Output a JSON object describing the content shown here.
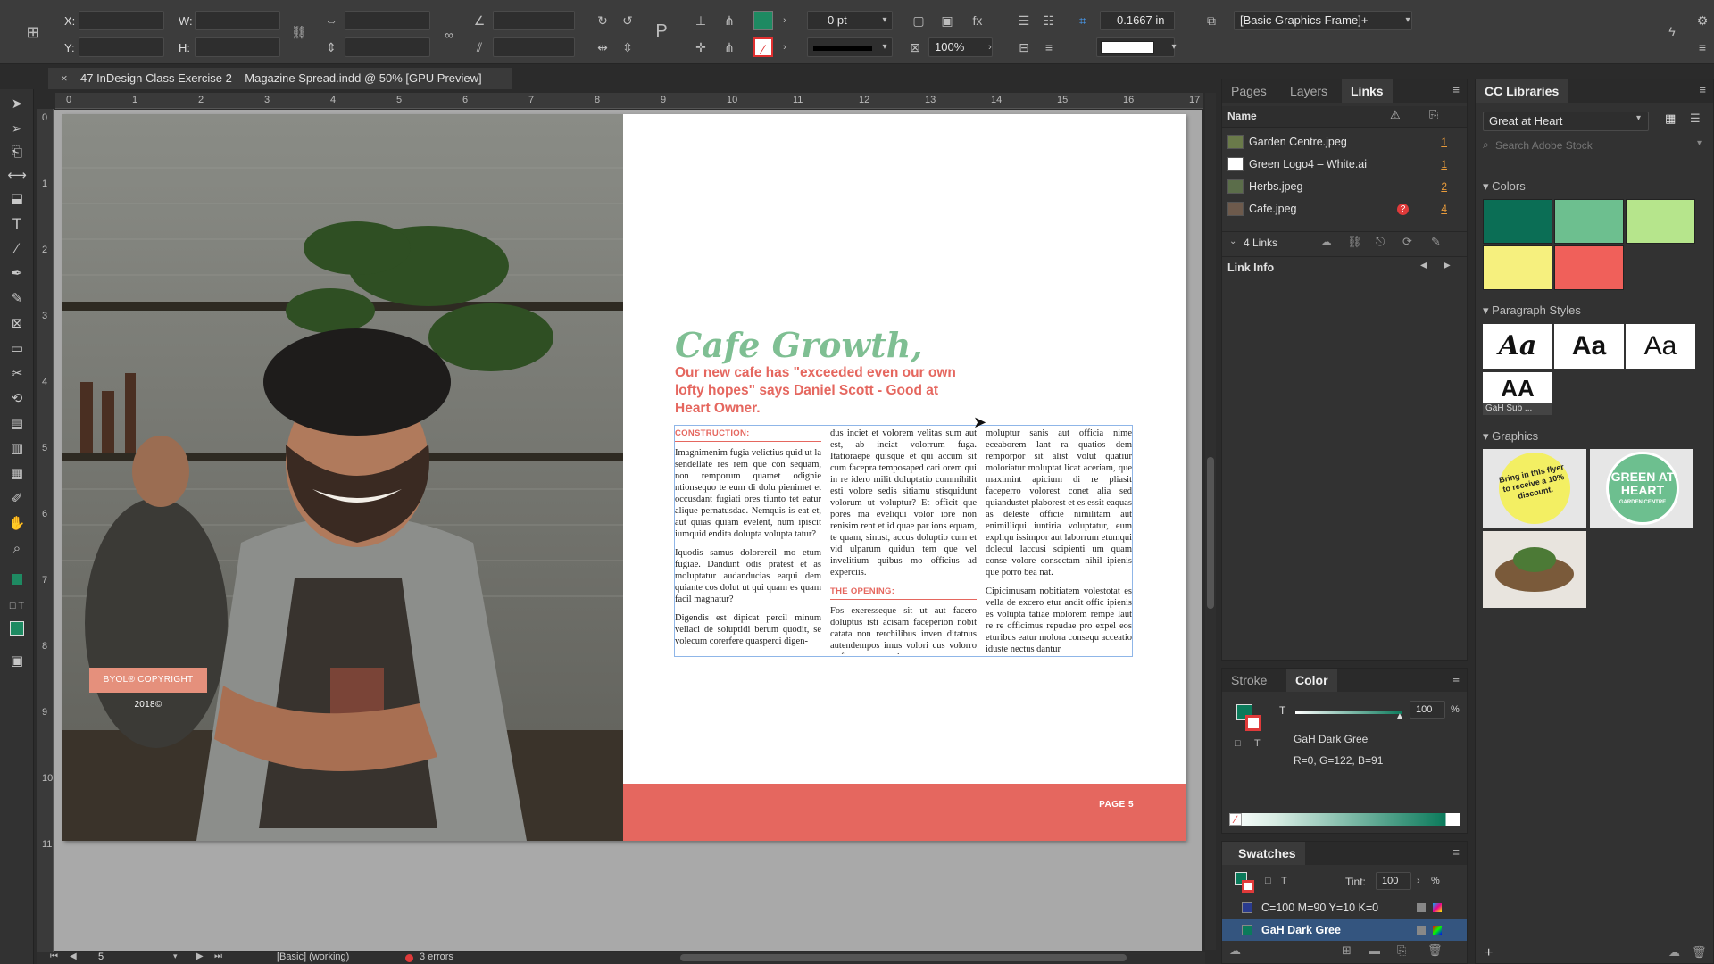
{
  "control_bar": {
    "x_label": "X:",
    "y_label": "Y:",
    "w_label": "W:",
    "h_label": "H:",
    "stroke_weight": "0 pt",
    "opacity": "100%",
    "offset": "0.1667 in",
    "object_style": "[Basic Graphics Frame]+"
  },
  "document": {
    "tab_title": "47 InDesign Class Exercise 2 – Magazine Spread.indd @ 50% [GPU Preview]",
    "close_glyph": "×"
  },
  "ruler": {
    "h_ticks": [
      "0",
      "1",
      "2",
      "3",
      "4",
      "5",
      "6",
      "7",
      "8",
      "9",
      "10",
      "11",
      "12",
      "13",
      "14",
      "15",
      "16",
      "17"
    ],
    "v_ticks": [
      "0",
      "1",
      "2",
      "3",
      "4",
      "5",
      "6",
      "7",
      "8",
      "9",
      "10",
      "11"
    ]
  },
  "spread": {
    "copyright": "BYOL® COPYRIGHT 2018©",
    "headline": "Cafe Growth,",
    "subhead": "Our new cafe has \"exceeded even our own lofty hopes\" says Daniel Scott - Good at Heart Owner.",
    "page_label": "PAGE 5",
    "col1_head": "CONSTRUCTION:",
    "col1_p1": "Imagnimenim fugia velictius quid ut la sendellate res rem que con sequam, non remporum quamet odignie ntionsequo te eum di dolu pienimet et occusdant fugiati ores tiunto tet eatur alique pernatusdae. Nemquis is eat et, aut quias quiam evelent, num ipiscit iumquid endita dolupta volupta tatur?",
    "col1_p2": "Iquodis samus dolorercil mo etum fugiae. Dandunt odis pratest et as moluptatur audanducias eaqui dem quiante cos dolut ut qui quam es quam facil magnatur?",
    "col1_p3": "Digendis est dipicat percil minum vellaci de soluptidi berum quodit, se volecum corerfere quasperci digen-",
    "col2_p1": "dus inciet et volorem velitas sum aut est, ab inciat volorrum fuga. Itatioraepe quisque et qui accum sit cum facepra temposaped cari orem qui in re idero milit doluptatio commihilit esti volore sedis sitiamu stisquidunt volorum ut voluptur? Et officit que pores ma eveliqui volor iore non renisim rent et id quae par ions equam, te quam, sinust, accus doluptio cum et vid ulparum quidun tem que vel invelitium quibus mo officius ad experciis.",
    "col2_head": "THE OPENING:",
    "col2_p2": "Fos exeresseque sit ut aut facero doluptus isti acisam faceperion nobit catata non rerchilibus inven ditatnus autendempos imus volori cus volorro rerferspe nonsequiae",
    "col3_p1": "moluptur sanis aut officia nime eceaborem lant ra quatios dem remporpor sit alist volut quatiur moloriatur moluptat licat aceriam, que maximint apicium di re pliasit faceperro volorest conet alia sed quiandustet plaborest et es essit eaquas as deleste officie nimilitam aut enimilliqui iuntiria voluptatur, eum expliqu issimpor aut laborrum etumqui dolecul laccusi scipienti um quam conse volore consectam nihil ipienis que porro bea nat.",
    "col3_p2": "Cipicimusam nobitiatem volestotat es vella de excero etur andit offic ipienis es volupta tatiae molorem rempe laut re re officimus repudae pro expel eos eturibus eatur molora consequ acceatio iduste nectus dantur"
  },
  "links_panel": {
    "tabs": [
      "Pages",
      "Layers",
      "Links"
    ],
    "name_header": "Name",
    "links": [
      {
        "name": "Garden Centre.jpeg",
        "page": "1"
      },
      {
        "name": "Green Logo4 – White.ai",
        "page": "1"
      },
      {
        "name": "Herbs.jpeg",
        "page": "2"
      },
      {
        "name": "Cafe.jpeg",
        "page": "4"
      }
    ],
    "count": "4 Links",
    "link_info": "Link Info"
  },
  "cc_libraries": {
    "title": "CC Libraries",
    "library": "Great at Heart",
    "search_placeholder": "Search Adobe Stock",
    "colors_head": "Colors",
    "colors": [
      "#0b6e55",
      "#6dbf8f",
      "#b6e58c",
      "#f6f07e",
      "#f0605a"
    ],
    "pstyles_head": "Paragraph Styles",
    "pstyles": [
      "Aa",
      "Aa",
      "Aa",
      "AA"
    ],
    "pstyle_caption": "GaH Sub ...",
    "graphics_head": "Graphics",
    "flyer_text": "Bring in this flyer to receive a 10% discount.",
    "logo_text": "GREEN AT HEART",
    "logo_sub": "GARDEN CENTRE"
  },
  "color_panel": {
    "tabs": [
      "Stroke",
      "Color"
    ],
    "tint": "100",
    "percent": "%",
    "swatch_name": "GaH Dark Gree",
    "rgb": "R=0, G=122, B=91"
  },
  "swatches_panel": {
    "title": "Swatches",
    "tint_label": "Tint:",
    "tint_value": "100",
    "percent": "%",
    "rows": [
      {
        "name": "C=100 M=90 Y=10 K=0",
        "color": "#2a3b8f"
      },
      {
        "name": "GaH Dark Gree",
        "color": "#0b7a5b"
      }
    ]
  },
  "status_bar": {
    "page": "5",
    "preflight_profile": "[Basic] (working)",
    "errors": "3 errors"
  }
}
